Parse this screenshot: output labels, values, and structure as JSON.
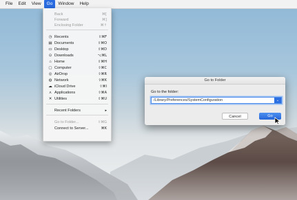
{
  "menubar": {
    "items": [
      "File",
      "Edit",
      "View",
      "Go",
      "Window",
      "Help"
    ],
    "active_index": 3
  },
  "go_menu": {
    "items": [
      {
        "label": "Back",
        "shortcut": "⌘[",
        "icon": "",
        "disabled": true
      },
      {
        "label": "Forward",
        "shortcut": "⌘]",
        "icon": "",
        "disabled": true
      },
      {
        "label": "Enclosing Folder",
        "shortcut": "⌘↑",
        "icon": "",
        "disabled": true
      },
      {
        "label": "Recents",
        "shortcut": "⇧⌘F",
        "icon": "recents-icon",
        "disabled": false
      },
      {
        "label": "Documents",
        "shortcut": "⇧⌘O",
        "icon": "documents-icon",
        "disabled": false
      },
      {
        "label": "Desktop",
        "shortcut": "⇧⌘D",
        "icon": "desktop-icon",
        "disabled": false
      },
      {
        "label": "Downloads",
        "shortcut": "⌥⌘L",
        "icon": "downloads-icon",
        "disabled": false
      },
      {
        "label": "Home",
        "shortcut": "⇧⌘H",
        "icon": "home-icon",
        "disabled": false
      },
      {
        "label": "Computer",
        "shortcut": "⇧⌘C",
        "icon": "computer-icon",
        "disabled": false
      },
      {
        "label": "AirDrop",
        "shortcut": "⇧⌘R",
        "icon": "airdrop-icon",
        "disabled": false
      },
      {
        "label": "Network",
        "shortcut": "⇧⌘K",
        "icon": "network-icon",
        "disabled": false
      },
      {
        "label": "iCloud Drive",
        "shortcut": "⇧⌘I",
        "icon": "icloud-icon",
        "disabled": false
      },
      {
        "label": "Applications",
        "shortcut": "⇧⌘A",
        "icon": "applications-icon",
        "disabled": false
      },
      {
        "label": "Utilities",
        "shortcut": "⇧⌘U",
        "icon": "utilities-icon",
        "disabled": false
      },
      {
        "label": "Recent Folders",
        "shortcut": "▸",
        "icon": "",
        "disabled": false
      },
      {
        "label": "Go to Folder...",
        "shortcut": "⇧⌘G",
        "icon": "",
        "disabled": true
      },
      {
        "label": "Connect to Server...",
        "shortcut": "⌘K",
        "icon": "",
        "disabled": false
      }
    ]
  },
  "dialog": {
    "title": "Go to Folder",
    "prompt": "Go to the folder:",
    "path_value": "/Library/Preferences/SystemConfiguration",
    "cancel_label": "Cancel",
    "go_label": "Go"
  },
  "colors": {
    "accent": "#2a6ce0",
    "menu_bg": "#f6f6f6"
  }
}
